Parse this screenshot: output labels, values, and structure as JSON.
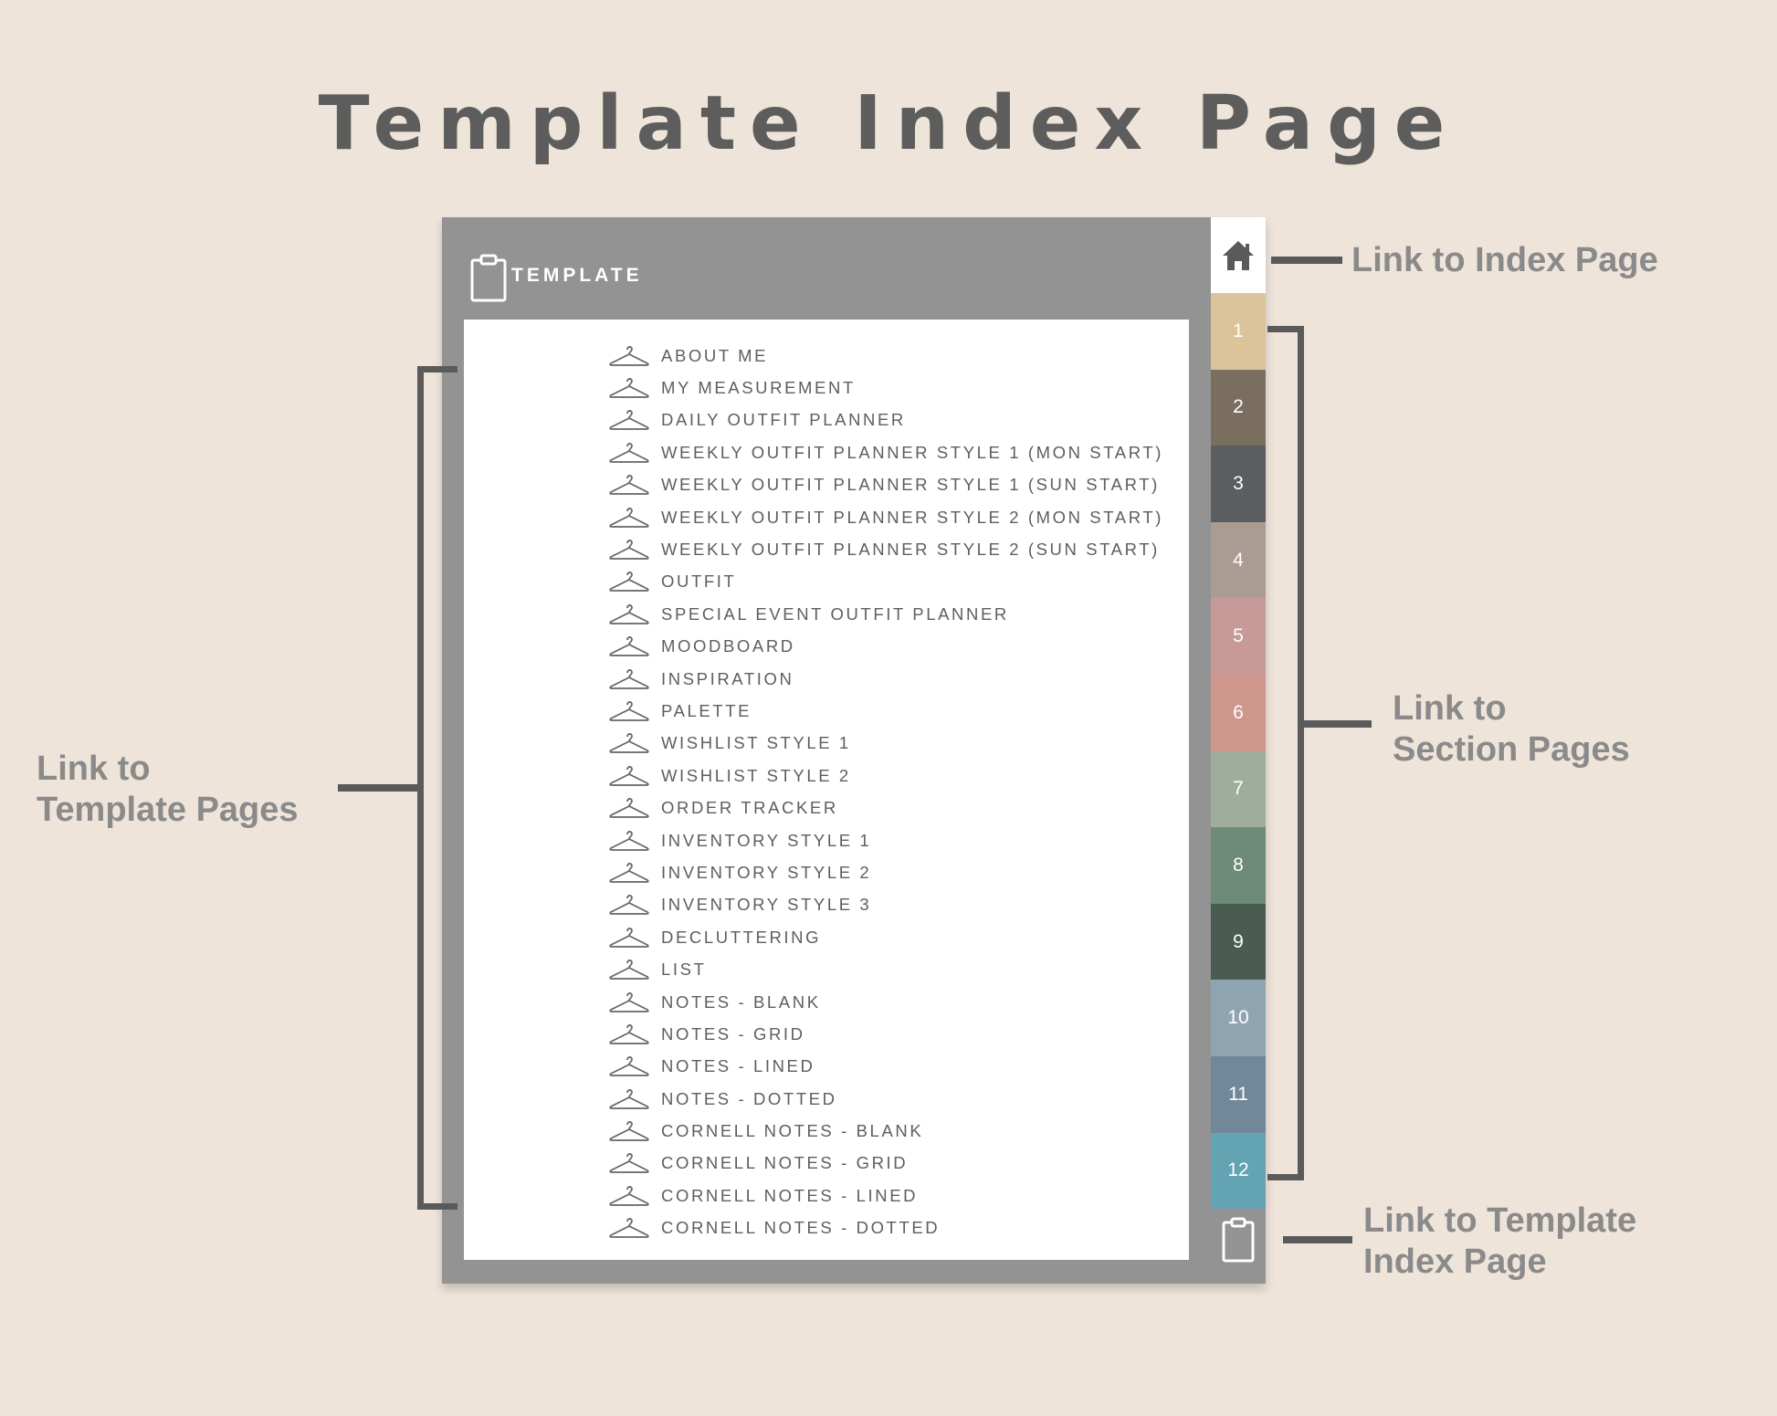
{
  "title": "Template Index Page",
  "header": {
    "label": "TEMPLATE"
  },
  "template_items": [
    "ABOUT ME",
    "MY MEASUREMENT",
    "DAILY OUTFIT PLANNER",
    "WEEKLY OUTFIT PLANNER STYLE 1 (MON START)",
    "WEEKLY OUTFIT PLANNER STYLE 1 (SUN START)",
    "WEEKLY OUTFIT PLANNER STYLE 2 (MON START)",
    "WEEKLY OUTFIT PLANNER STYLE 2 (SUN START)",
    "OUTFIT",
    "SPECIAL EVENT OUTFIT PLANNER",
    "MOODBOARD",
    "INSPIRATION",
    "PALETTE",
    "WISHLIST STYLE 1",
    "WISHLIST STYLE 2",
    "ORDER TRACKER",
    "INVENTORY STYLE 1",
    "INVENTORY STYLE 2",
    "INVENTORY STYLE 3",
    "DECLUTTERING",
    "LIST",
    "NOTES - BLANK",
    "NOTES - GRID",
    "NOTES - LINED",
    "NOTES - DOTTED",
    "CORNELL NOTES - BLANK",
    "CORNELL NOTES - GRID",
    "CORNELL NOTES - LINED",
    "CORNELL NOTES - DOTTED"
  ],
  "item_icon": "hanger-icon",
  "home_tab_icon": "home-icon",
  "template_tab_icon": "clipboard-icon",
  "tabs": [
    {
      "label": "1",
      "color": "#dcc49a"
    },
    {
      "label": "2",
      "color": "#7a6f5e"
    },
    {
      "label": "3",
      "color": "#5b5d60"
    },
    {
      "label": "4",
      "color": "#ab9c93"
    },
    {
      "label": "5",
      "color": "#c79a97"
    },
    {
      "label": "6",
      "color": "#cf978b"
    },
    {
      "label": "7",
      "color": "#9fae9c"
    },
    {
      "label": "8",
      "color": "#6e8a79"
    },
    {
      "label": "9",
      "color": "#4a5c52"
    },
    {
      "label": "10",
      "color": "#8fa4b1"
    },
    {
      "label": "11",
      "color": "#71889b"
    },
    {
      "label": "12",
      "color": "#63a3b2"
    }
  ],
  "annotations": {
    "index_page": "Link to Index Page",
    "section_line1": "Link to",
    "section_line2": "Section Pages",
    "template_pages_line1": "Link to",
    "template_pages_line2": "Template Pages",
    "template_index_line1": "Link to Template",
    "template_index_line2": "Index Page"
  }
}
